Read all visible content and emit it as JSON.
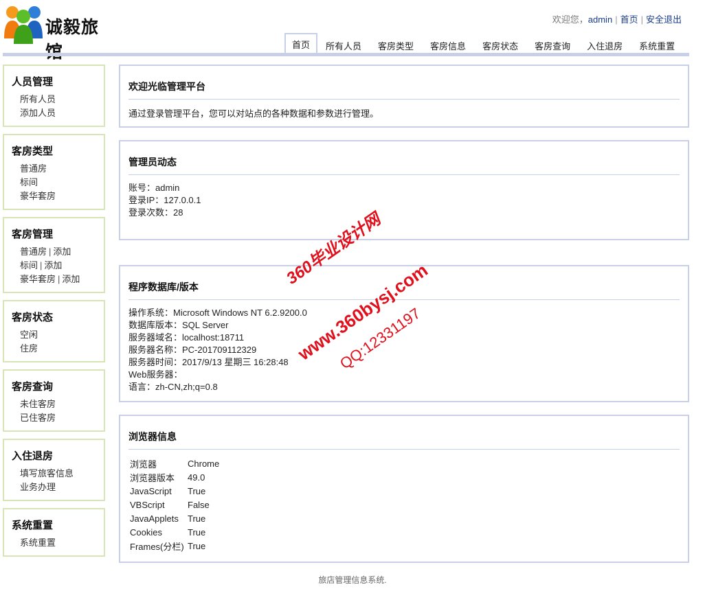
{
  "header": {
    "logo_text": "诚毅旅馆",
    "welcome_label": "欢迎您，",
    "username": "admin",
    "home_link": "首页",
    "logout_link": "安全退出"
  },
  "nav": [
    {
      "label": "首页",
      "active": true
    },
    {
      "label": "所有人员"
    },
    {
      "label": "客房类型"
    },
    {
      "label": "客房信息"
    },
    {
      "label": "客房状态"
    },
    {
      "label": "客房查询"
    },
    {
      "label": "入住退房"
    },
    {
      "label": "系统重置"
    }
  ],
  "sidebar": {
    "personnel": {
      "title": "人员管理",
      "links": [
        "所有人员",
        "添加人员"
      ]
    },
    "room_types": {
      "title": "客房类型",
      "links": [
        "普通房",
        "标间",
        "豪华套房"
      ]
    },
    "room_mgmt": {
      "title": "客房管理",
      "rows": [
        {
          "name": "普通房",
          "add": "添加"
        },
        {
          "name": "标间",
          "add": "添加"
        },
        {
          "name": "豪华套房",
          "add": "添加"
        }
      ]
    },
    "room_status": {
      "title": "客房状态",
      "links": [
        "空闲",
        "住房"
      ]
    },
    "room_query": {
      "title": "客房查询",
      "links": [
        "未住客房",
        "已住客房"
      ]
    },
    "checkin": {
      "title": "入住退房",
      "links": [
        "填写旅客信息",
        "业务办理"
      ]
    },
    "reset": {
      "title": "系统重置",
      "links": [
        "系统重置"
      ]
    }
  },
  "welcome_panel": {
    "title": "欢迎光临管理平台",
    "text": "通过登录管理平台，您可以对站点的各种数据和参数进行管理。"
  },
  "admin_panel": {
    "title": "管理员动态",
    "lines": [
      "账号：admin",
      "登录IP：127.0.0.1",
      "登录次数：28"
    ]
  },
  "db_panel": {
    "title": "程序数据库/版本",
    "lines": [
      "操作系统：Microsoft Windows NT 6.2.9200.0",
      "数据库版本：SQL Server",
      "服务器域名：localhost:18711",
      "服务器名称：PC-201709112329",
      "服务器时间：2017/9/13 星期三 16:28:48",
      "Web服务器：",
      "语言：zh-CN,zh;q=0.8"
    ]
  },
  "browser_panel": {
    "title": "浏览器信息",
    "rows": [
      {
        "k": "浏览器",
        "v": "Chrome"
      },
      {
        "k": "浏览器版本",
        "v": "49.0"
      },
      {
        "k": "JavaScript",
        "v": "True"
      },
      {
        "k": "VBScript",
        "v": "False"
      },
      {
        "k": "JavaApplets",
        "v": "True"
      },
      {
        "k": "Cookies",
        "v": "True"
      },
      {
        "k": "Frames(分栏)",
        "v": "True"
      }
    ]
  },
  "footer": "旅店管理信息系统.",
  "watermark": {
    "line1": "360毕业设计网",
    "line2": "www.360bysj.com",
    "line3": "QQ:12331197"
  },
  "colors": {
    "panel_border": "#c8d0e8",
    "sidebar_border": "#d6e4b6",
    "watermark": "#e0101c"
  }
}
